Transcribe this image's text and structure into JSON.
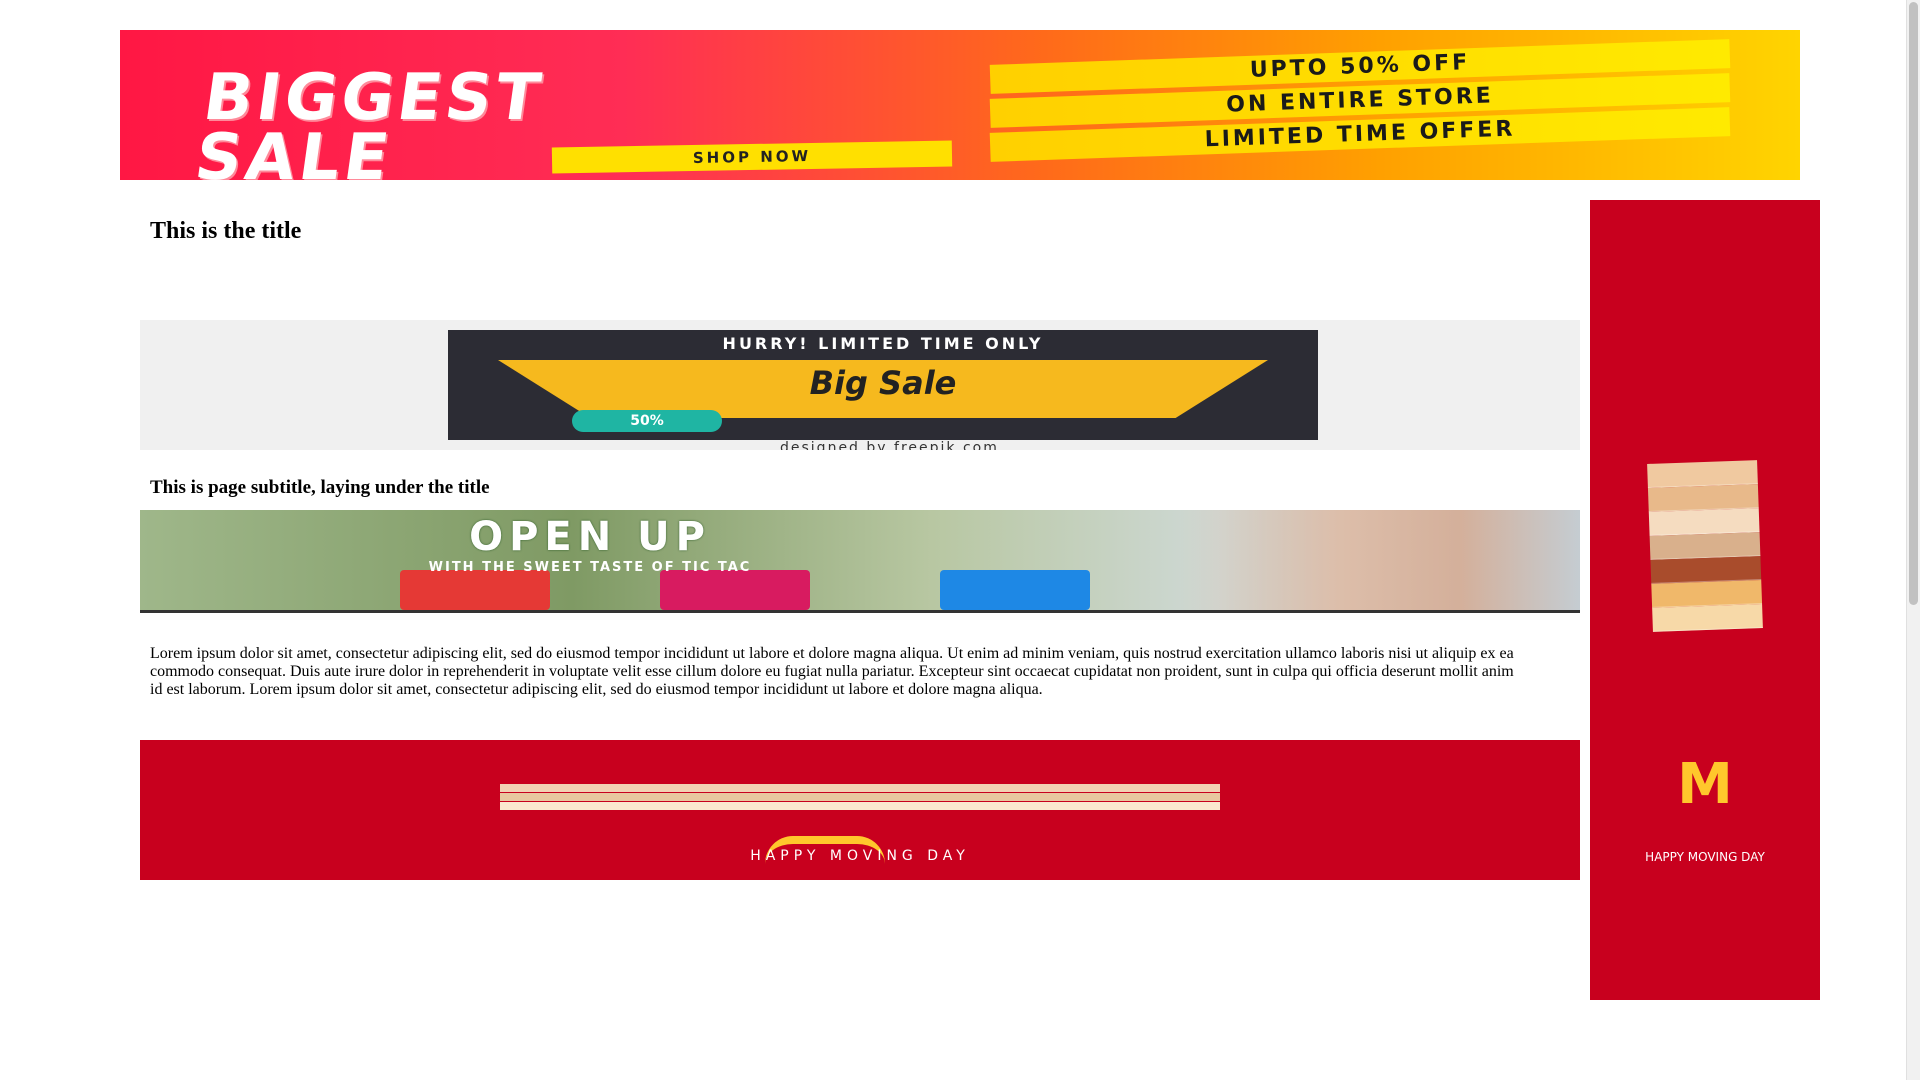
{
  "top_banner": {
    "headline_line1": "BIGGEST",
    "headline_line2": "SALE",
    "cta": "SHOP NOW",
    "offer_line1": "UPTO 50% OFF",
    "offer_line2": "ON ENTIRE STORE",
    "offer_line3": "LIMITED TIME OFFER"
  },
  "page": {
    "title": "This is the title",
    "subtitle": "This is page subtitle, laying under the title",
    "body": "Lorem ipsum dolor sit amet, consectetur adipiscing elit, sed do eiusmod tempor incididunt ut labore et dolore magna aliqua. Ut enim ad minim veniam, quis nostrud exercitation ullamco laboris nisi ut aliquip ex ea commodo consequat. Duis aute irure dolor in reprehenderit in voluptate velit esse cillum dolore eu fugiat nulla pariatur. Excepteur sint occaecat cupidatat non proident, sunt in culpa qui officia deserunt mollit anim id est laborum. Lorem ipsum dolor sit amet, consectetur adipiscing elit, sed do eiusmod tempor incididunt ut labore et dolore magna aliqua."
  },
  "mid_banner": {
    "line1": "HURRY! LIMITED TIME ONLY",
    "headline": "Big Sale",
    "badge": "50%",
    "credit": "designed by freepik.com"
  },
  "openup_banner": {
    "headline": "OPEN UP",
    "subline": "WITH THE SWEET TASTE OF TIC TAC"
  },
  "bottom_ad": {
    "tagline": "HAPPY MOVING DAY"
  },
  "side_ad": {
    "logo": "M",
    "tagline": "HAPPY MOVING DAY",
    "swatch_colors": [
      "#f0c9a0",
      "#e8b98a",
      "#f5dcc0",
      "#d9b08c",
      "#a94c2c",
      "#f0b86a",
      "#f7d9a8"
    ]
  },
  "colors": {
    "ad_red": "#c8001e",
    "arches_yellow": "#ffc72c"
  }
}
